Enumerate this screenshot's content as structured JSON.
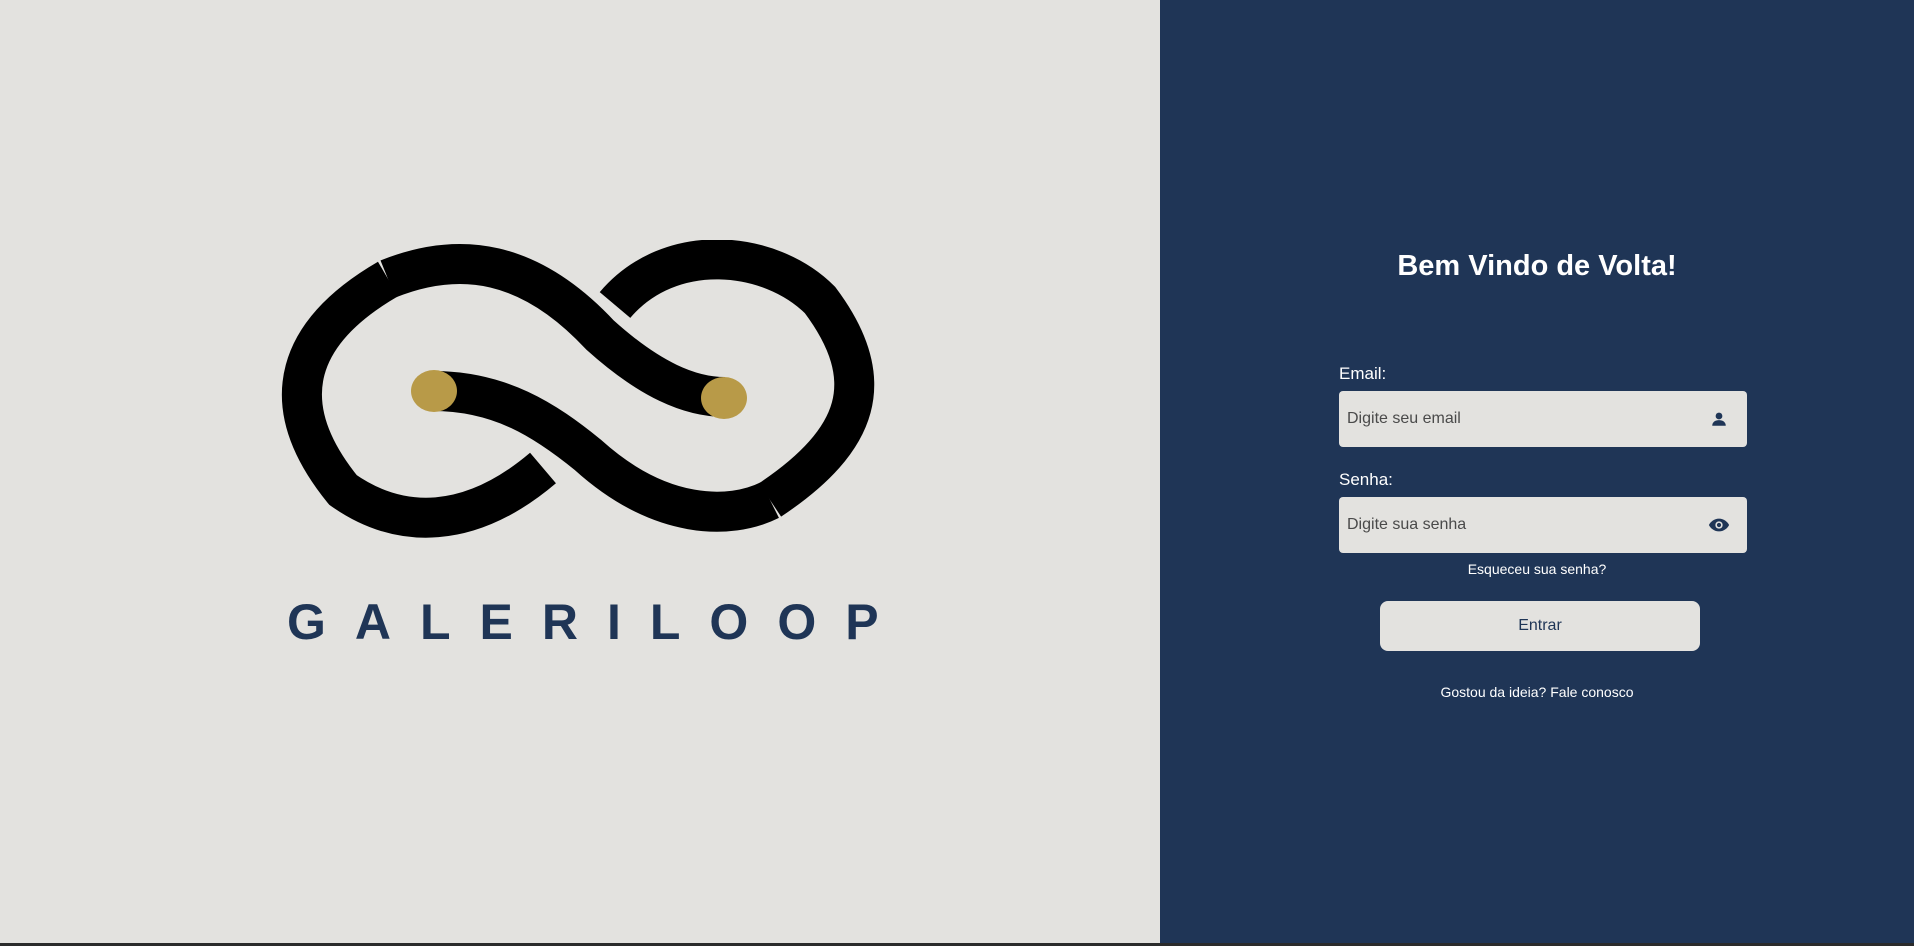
{
  "brand": {
    "name": "GALERILOOP",
    "colors": {
      "navy": "#1f3556",
      "gold": "#b89a48",
      "cream": "#e3e2df",
      "black": "#000000"
    }
  },
  "login": {
    "title": "Bem Vindo de Volta!",
    "email_label": "Email:",
    "email_placeholder": "Digite seu email",
    "email_icon": "user-icon",
    "password_label": "Senha:",
    "password_placeholder": "Digite sua senha",
    "password_icon": "eye-icon",
    "forgot_link": "Esqueceu sua senha?",
    "submit_label": "Entrar",
    "footer_text": "Gostou da ideia?",
    "footer_link": "Fale conosco"
  }
}
